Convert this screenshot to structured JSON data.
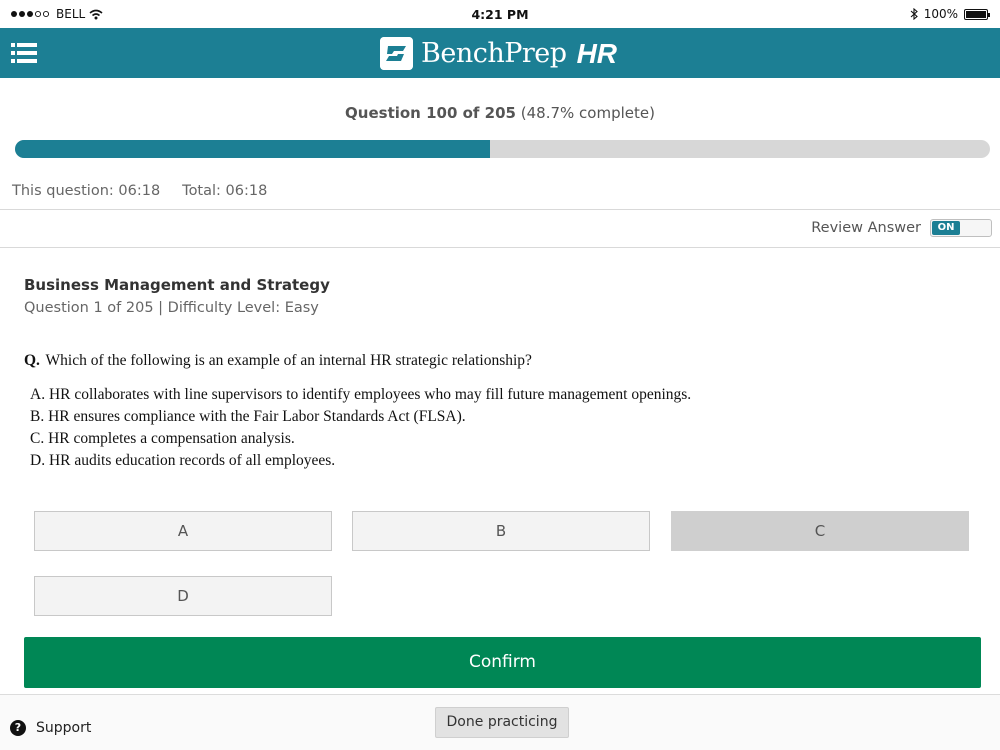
{
  "status_bar": {
    "carrier": "BELL",
    "time": "4:21 PM",
    "battery": "100%",
    "battery_level": 1.0,
    "icons": [
      "signal-dots-icon",
      "wifi-icon",
      "bluetooth-icon",
      "battery-icon"
    ]
  },
  "header": {
    "brand_name": "BenchPrep",
    "brand_suffix": "HR",
    "bg_color": "#1c7f94",
    "menu_icon": "list-menu-icon"
  },
  "progress": {
    "label_bold": "Question 100 of 205",
    "label_extra": "(48.7% complete)",
    "percent": 48.7,
    "fill_color": "#1c7f94"
  },
  "timers": {
    "this_question": "This question: 06:18",
    "total": "Total: 06:18"
  },
  "review": {
    "label": "Review Answer",
    "toggle_state": "ON"
  },
  "question": {
    "category": "Business Management and Strategy",
    "meta": "Question 1 of 205 | Difficulty Level: Easy",
    "prefix": "Q.",
    "text": "Which of the following is an example of an internal HR strategic relationship?",
    "options": [
      "A. HR collaborates with line supervisors to identify employees who may fill future management openings.",
      "B. HR ensures compliance with the Fair Labor Standards Act (FLSA).",
      "C. HR completes a compensation analysis.",
      "D. HR audits education records of all employees."
    ]
  },
  "answers": [
    {
      "label": "A",
      "selected": false
    },
    {
      "label": "B",
      "selected": false
    },
    {
      "label": "C",
      "selected": true
    },
    {
      "label": "D",
      "selected": false
    }
  ],
  "confirm": {
    "label": "Confirm",
    "color": "#008755"
  },
  "footer": {
    "support_label": "Support",
    "support_icon": "question-circle-icon",
    "done_label": "Done practicing"
  }
}
